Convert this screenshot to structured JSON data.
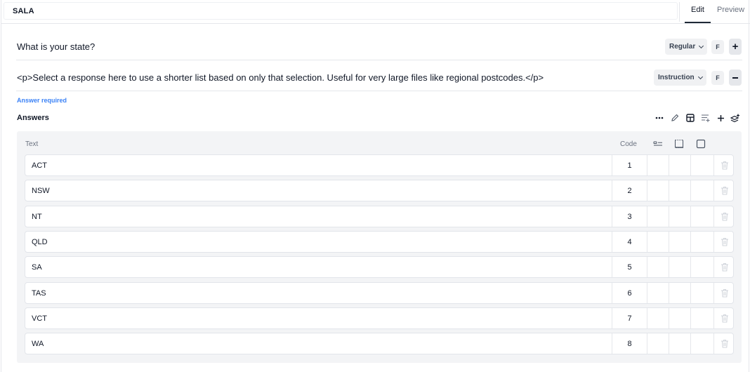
{
  "header": {
    "title": "SALA",
    "tabs": [
      {
        "label": "Edit",
        "active": true
      },
      {
        "label": "Preview",
        "active": false
      }
    ]
  },
  "question": {
    "text": "What is your state?",
    "type_label": "Regular",
    "f_label": "F"
  },
  "instruction": {
    "text": "<p>Select a response here to use a shorter list based on only that selection.  Useful for very large files like regional postcodes.</p>",
    "type_label": "Instruction",
    "f_label": "F"
  },
  "answer_required": "Answer required",
  "answers": {
    "title": "Answers",
    "toolbar_icons": [
      "more-icon",
      "pencil-icon",
      "layout-icon",
      "list-add-icon",
      "plus-icon",
      "layers-add-icon"
    ],
    "columns": {
      "text": "Text",
      "code": "Code"
    },
    "rows": [
      {
        "text": "ACT",
        "code": "1"
      },
      {
        "text": "NSW",
        "code": "2"
      },
      {
        "text": "NT",
        "code": "3"
      },
      {
        "text": "QLD",
        "code": "4"
      },
      {
        "text": "SA",
        "code": "5"
      },
      {
        "text": "TAS",
        "code": "6"
      },
      {
        "text": "VCT",
        "code": "7"
      },
      {
        "text": "WA",
        "code": "8"
      }
    ]
  },
  "colors": {
    "accent": "#3b82f6",
    "table_bg": "#f3f4f6",
    "text": "#111827"
  }
}
